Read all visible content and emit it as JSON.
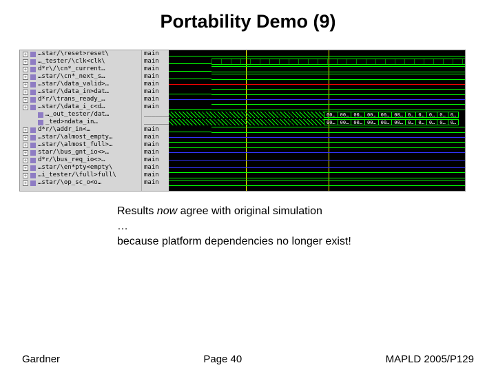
{
  "title": "Portability Demo (9)",
  "signals": [
    {
      "name": "…star/\\reset>reset\\",
      "value": "main"
    },
    {
      "name": "…_tester/\\clk<clk\\",
      "value": "main"
    },
    {
      "name": "d*r\\/\\cn*_current…",
      "value": "main"
    },
    {
      "name": "…star/\\cn*_next_s…",
      "value": "main"
    },
    {
      "name": "…star/\\data_valid>…",
      "value": "main"
    },
    {
      "name": "…star/\\data_in>dat…",
      "value": "main"
    },
    {
      "name": "d*r/\\trans_ready_…",
      "value": "main"
    },
    {
      "name": "…star/\\data_i_c<d…",
      "value": "main"
    },
    {
      "name": "…_out_tester/dat…",
      "value": "___________"
    },
    {
      "name": "_ted>ndata_in…",
      "value": "___________"
    },
    {
      "name": "d*r/\\addr_in<…",
      "value": "main"
    },
    {
      "name": "…star/\\almost_empty…",
      "value": "main"
    },
    {
      "name": "…star/\\almost_full>…",
      "value": "main"
    },
    {
      "name": "star/\\bus_gnt_io<>…",
      "value": "main"
    },
    {
      "name": "d*r/\\bus_req_io<>…",
      "value": "main"
    },
    {
      "name": "…star/\\en*pty<empty\\",
      "value": "main"
    },
    {
      "name": "…i_tester/\\full>full\\",
      "value": "main"
    },
    {
      "name": "…star/\\op_sc_o<o…",
      "value": "main"
    }
  ],
  "data_row_a": [
    "00…",
    "00…",
    "00…",
    "00…",
    "00…",
    "00…",
    "0…",
    "0…",
    "0…",
    "0…",
    "0…"
  ],
  "data_row_b": [
    "00…",
    "00…",
    "00…",
    "00…",
    "00…",
    "00…",
    "0…",
    "0…",
    "0…",
    "0…",
    "0…"
  ],
  "caption": {
    "line1_pre": "Results ",
    "line1_em": "now",
    "line1_post": " agree with original simulation",
    "line2": "…",
    "line3": "because platform dependencies no longer exist!"
  },
  "footer": {
    "left": "Gardner",
    "center": "Page 40",
    "right": "MAPLD 2005/P129"
  }
}
